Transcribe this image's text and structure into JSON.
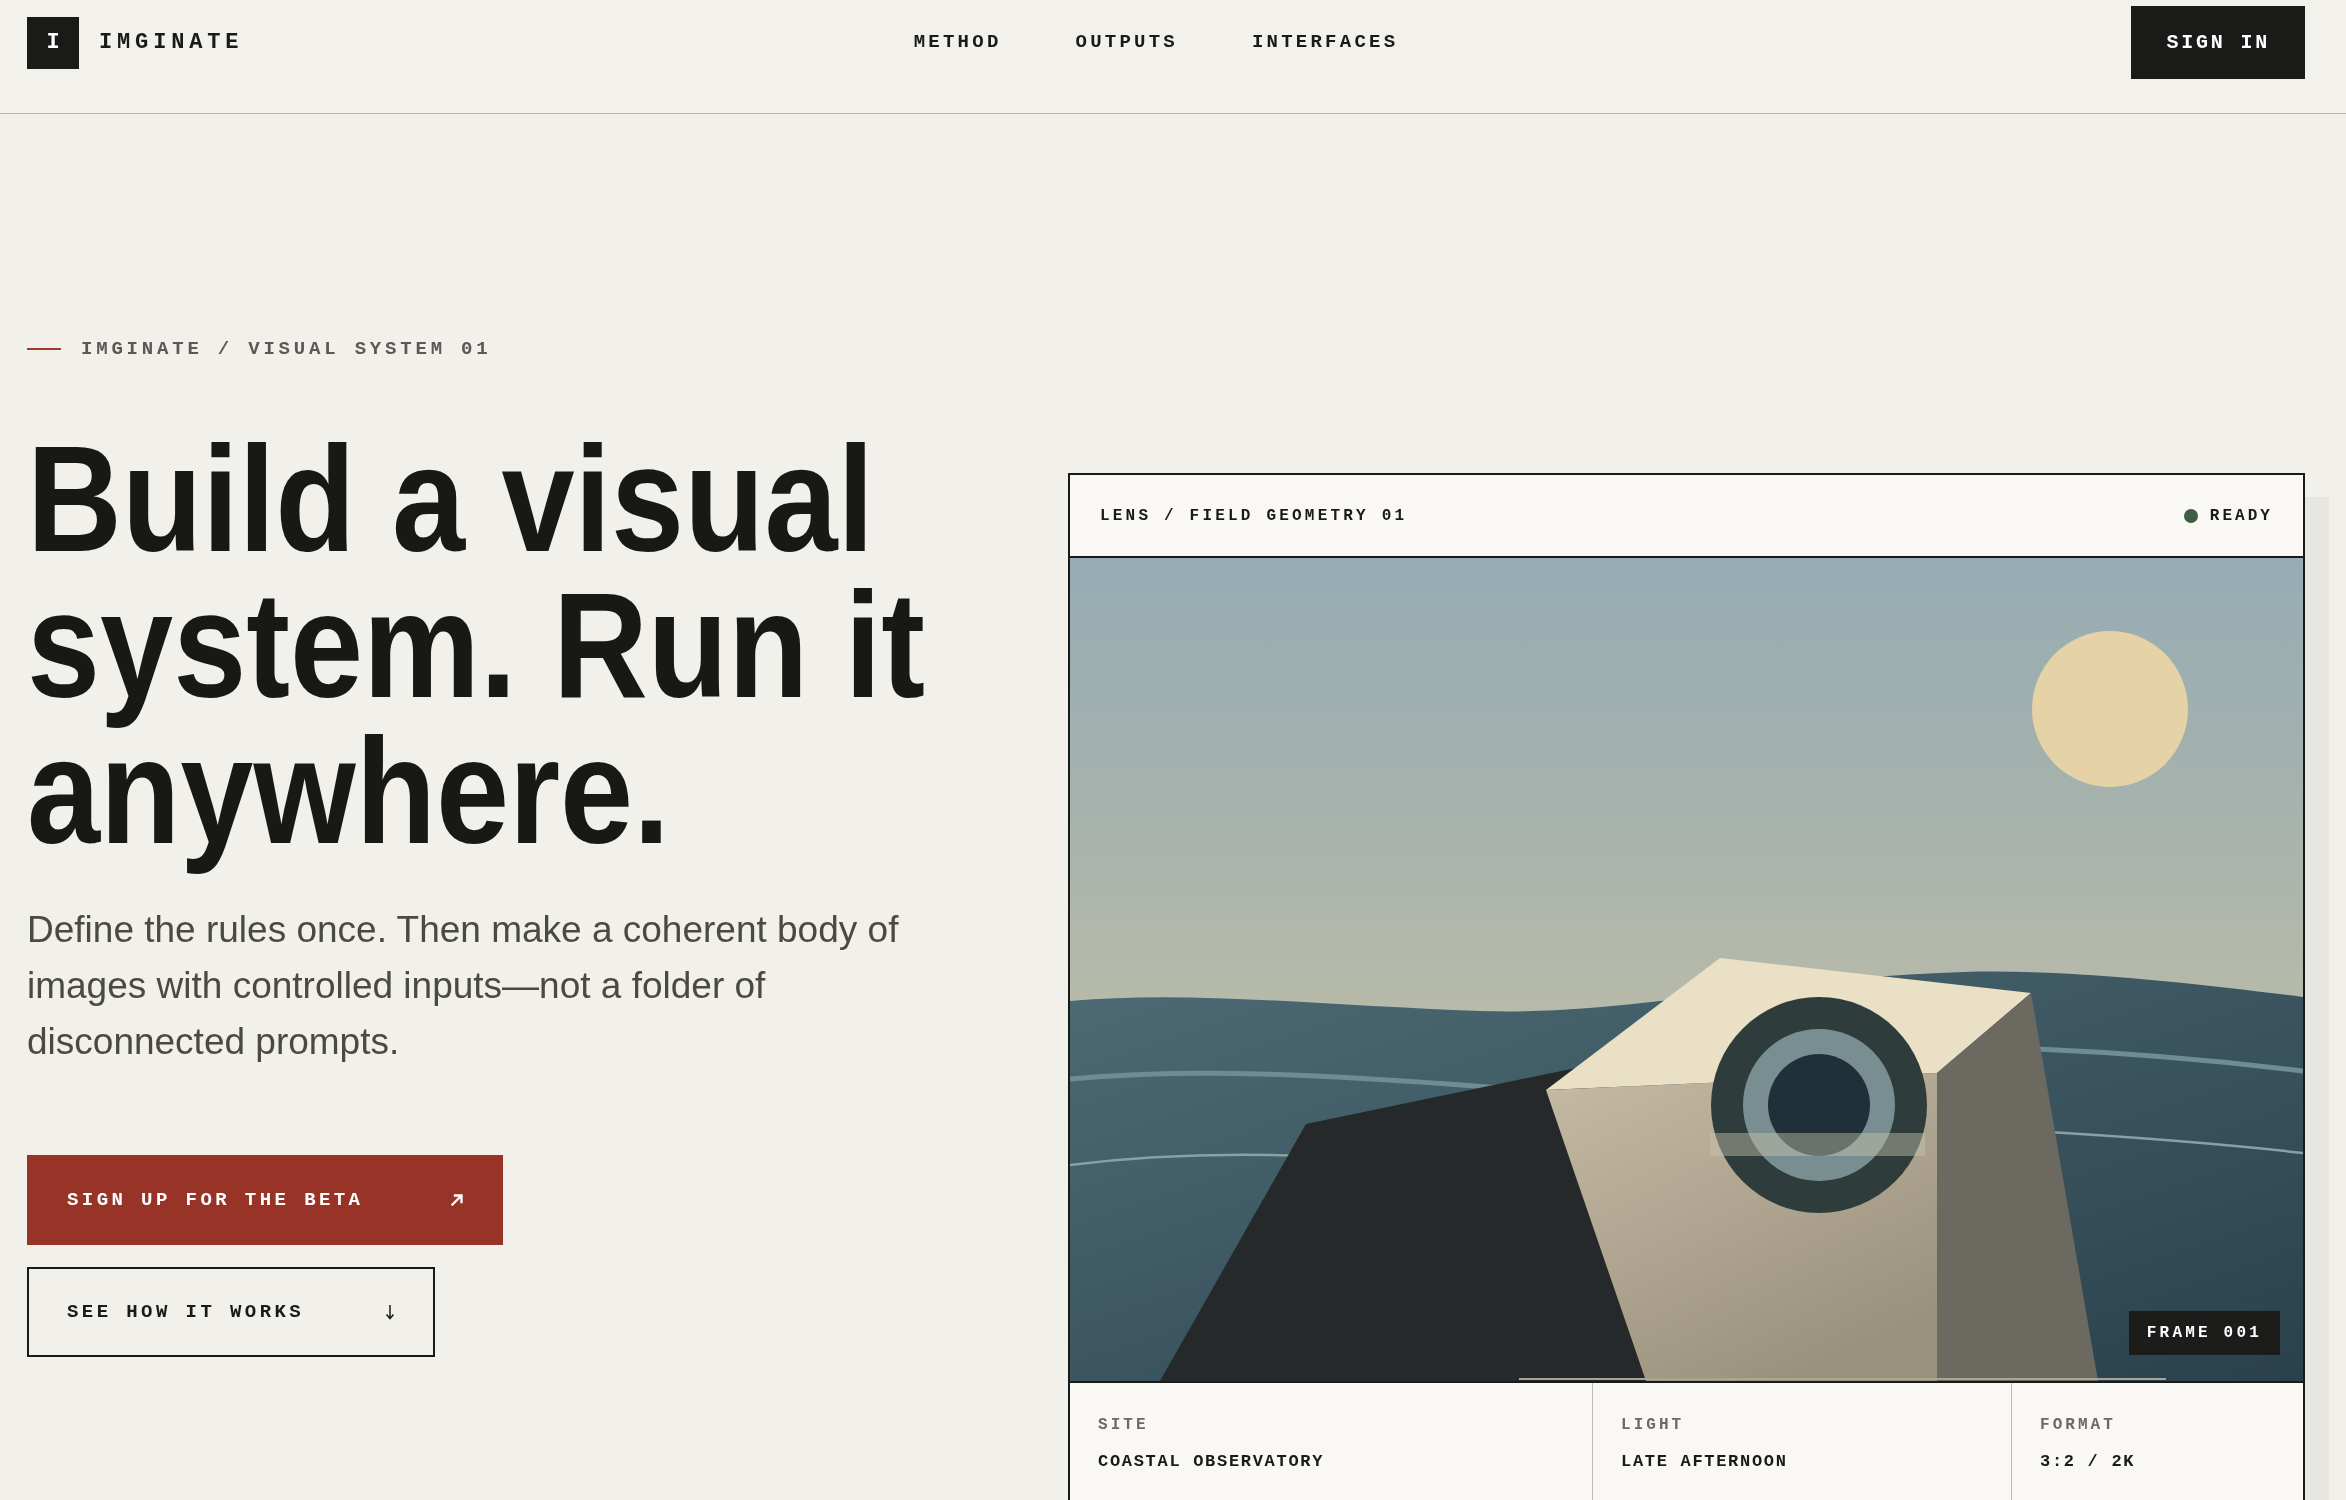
{
  "header": {
    "logo_mark": "I",
    "brand": "IMGINATE",
    "nav": [
      "METHOD",
      "OUTPUTS",
      "INTERFACES"
    ],
    "sign_in": "SIGN IN"
  },
  "hero": {
    "eyebrow": "IMGINATE / VISUAL SYSTEM 01",
    "headline": "Build a visual system. Run it anywhere.",
    "description": "Define the rules once. Then make a coherent body of images with controlled inputs—not a folder of disconnected prompts.",
    "buttons": [
      {
        "label": "SIGN UP FOR THE BETA",
        "kind": "primary"
      },
      {
        "label": "SEE HOW IT WORKS",
        "kind": "secondary"
      }
    ]
  },
  "preview_card": {
    "title": "LENS / FIELD GEOMETRY 01",
    "status": "READY",
    "frame_label": "FRAME 001",
    "details": [
      {
        "label": "SITE",
        "value": "COASTAL OBSERVATORY"
      },
      {
        "label": "LIGHT",
        "value": "LATE AFTERNOON"
      },
      {
        "label": "FORMAT",
        "value": "3:2 / 2K"
      }
    ]
  }
}
